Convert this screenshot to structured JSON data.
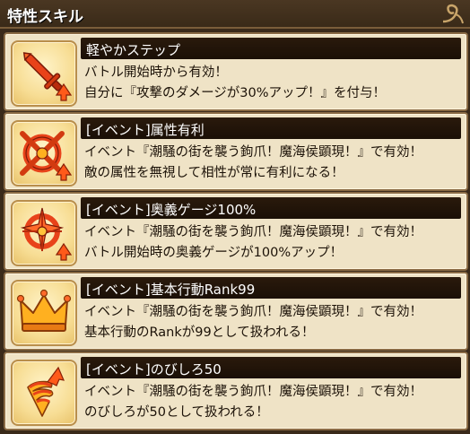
{
  "header": {
    "title": "特性スキル"
  },
  "skills": [
    {
      "title": "軽やかステップ",
      "icon": "sword-up-icon",
      "lines": [
        "バトル開始時から有効！",
        "自分に『攻撃のダメージが30%アップ！』を付与！"
      ]
    },
    {
      "title": "[イベント]属性有利",
      "icon": "crossed-circle-up-icon",
      "lines": [
        "イベント『潮騒の街を襲う鉤爪！魔海侯顕現！』で有効！",
        "敵の属性を無視して相性が常に有利になる！"
      ]
    },
    {
      "title": "[イベント]奥義ゲージ100%",
      "icon": "compass-burst-up-icon",
      "lines": [
        "イベント『潮騒の街を襲う鉤爪！魔海侯顕現！』で有効！",
        "バトル開始時の奥義ゲージが100%アップ！"
      ]
    },
    {
      "title": "[イベント]基本行動Rank99",
      "icon": "crown-icon",
      "lines": [
        "イベント『潮騒の街を襲う鉤爪！魔海侯顕現！』で有効！",
        "基本行動のRankが99として扱われる！"
      ]
    },
    {
      "title": "[イベント]のびしろ50",
      "icon": "spiral-up-icon",
      "lines": [
        "イベント『潮騒の街を襲う鉤爪！魔海侯顕現！』で有効！",
        "のびしろが50として扱われる！"
      ]
    }
  ]
}
